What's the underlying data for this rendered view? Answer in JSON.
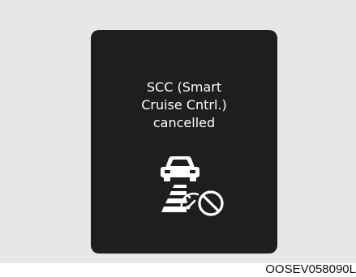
{
  "display": {
    "message_lines": [
      "SCC (Smart",
      "Cruise Cntrl.)",
      "cancelled"
    ],
    "icon": "scc-cancelled-icon",
    "background_color": "#1e1e1e",
    "text_color": "#ffffff"
  },
  "frame_color": "#e7e7e7",
  "caption": "OOSEV058090L"
}
